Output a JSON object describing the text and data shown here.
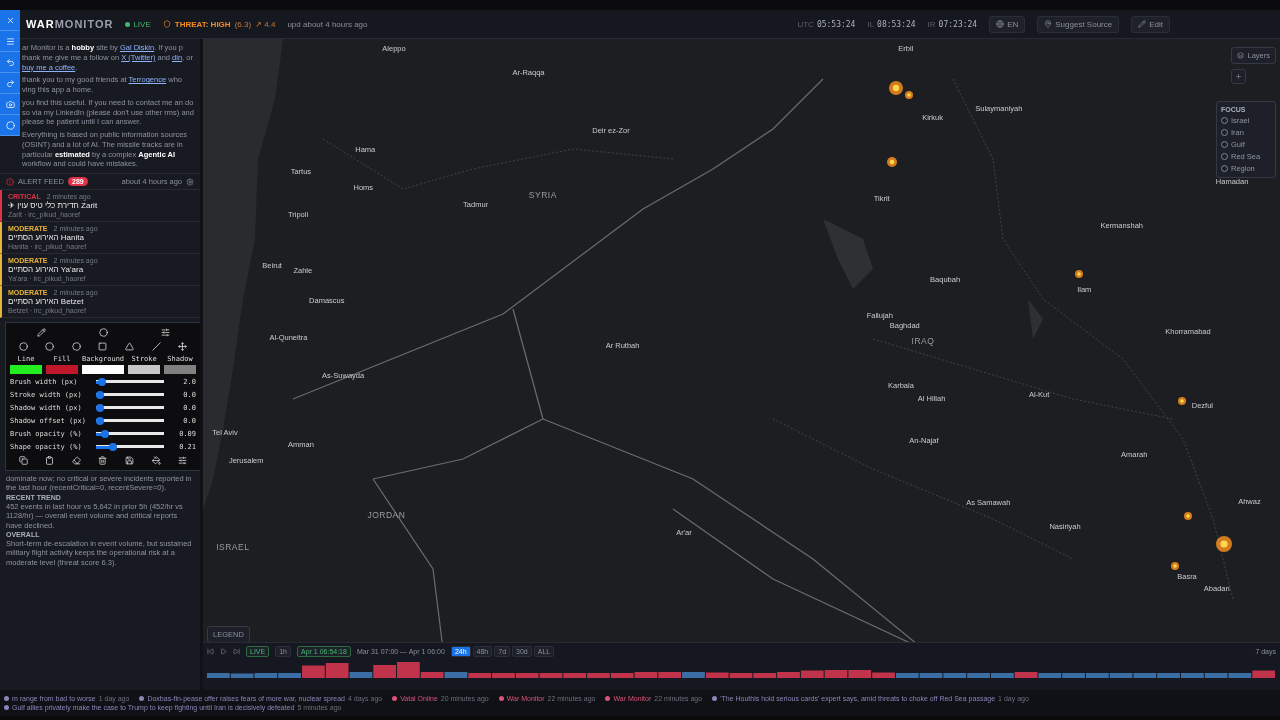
{
  "header": {
    "logo_strong": "WAR",
    "logo_rest": "MONITOR",
    "live": "LIVE",
    "threat": {
      "label": "THREAT: HIGH",
      "score": "(6.3)",
      "trend": "↗ 4.4"
    },
    "updated": "upd about 4 hours ago",
    "clocks": [
      {
        "zone": "UTC",
        "time": "05:53:24"
      },
      {
        "zone": "IL",
        "time": "08:53:24"
      },
      {
        "zone": "IR",
        "time": "07:23:24"
      }
    ],
    "language": "EN",
    "suggest": "Suggest Source",
    "edit": "Edit"
  },
  "about": [
    [
      {
        "kind": "text",
        "t": "ar Monitor is a "
      },
      {
        "kind": "bold",
        "t": "hobby"
      },
      {
        "kind": "text",
        "t": " site by "
      },
      {
        "kind": "link",
        "t": "Gal Diskin"
      },
      {
        "kind": "text",
        "t": ". If you p thank me give me a follow on "
      },
      {
        "kind": "link",
        "t": "X (Twitter)"
      },
      {
        "kind": "text",
        "t": " and "
      },
      {
        "kind": "link",
        "t": "din"
      },
      {
        "kind": "text",
        "t": ", or "
      },
      {
        "kind": "link",
        "t": "buy me a coffee"
      },
      {
        "kind": "text",
        "t": "."
      }
    ],
    [
      {
        "kind": "text",
        "t": "thank you to my good friends at "
      },
      {
        "kind": "link",
        "t": "Terrogence"
      },
      {
        "kind": "text",
        "t": " who ving this app a home."
      }
    ],
    [
      {
        "kind": "text",
        "t": "you find this useful. If you need to contact me an do so via my LinkedIn (please don't use other rms) and please be patient until I can answer."
      }
    ],
    [
      {
        "kind": "text",
        "t": "Everything is based on public information sources (OSINT) and a lot of AI. The missile tracks are in particular "
      },
      {
        "kind": "bold",
        "t": "estimated"
      },
      {
        "kind": "text",
        "t": " by a complex "
      },
      {
        "kind": "bold",
        "t": "Agentic AI"
      },
      {
        "kind": "text",
        "t": " workflow and could have mistakes."
      }
    ]
  ],
  "alert_feed": {
    "title": "ALERT FEED",
    "count": "289",
    "updated": "about 4 hours ago",
    "alerts": [
      {
        "severity": "CRITICAL",
        "kind": "critical",
        "time": "2 minutes ago",
        "title": "✈ חדירת כלי טיס עוין Zarit",
        "source": "Zarit · irc_pikud_haoref"
      },
      {
        "severity": "MODERATE",
        "kind": "moderate",
        "time": "2 minutes ago",
        "title": "האירוע הסתיים Hanita",
        "source": "Hanita · irc_pikud_haoref"
      },
      {
        "severity": "MODERATE",
        "kind": "moderate",
        "time": "2 minutes ago",
        "title": "האירוע הסתיים Ya'ara",
        "source": "Ya'ara · irc_pikud_haoref"
      },
      {
        "severity": "MODERATE",
        "kind": "moderate",
        "time": "2 minutes ago",
        "title": "האירוע הסתיים Betzet",
        "source": "Betzet · irc_pikud_haoref"
      }
    ]
  },
  "summary": [
    {
      "kind": "text",
      "t": "dominate now; no critical or severe incidents reported in the last hour (recentCritical=0, recentSevere=0)."
    },
    {
      "kind": "heading",
      "t": "RECENT TREND"
    },
    {
      "kind": "text",
      "t": "452 events in last hour vs 5,642 in prior 5h (452/hr vs 1128/hr) — overall event volume and critical reports have declined."
    },
    {
      "kind": "heading",
      "t": "OVERALL"
    },
    {
      "kind": "text",
      "t": "Short-term de-escalation in event volume, but sustained military flight activity keeps the operational risk at a moderate level (threat score 6.3)."
    }
  ],
  "drawing_panel": {
    "colors": [
      {
        "label": "Line",
        "color": "#22ee22"
      },
      {
        "label": "Fill",
        "color": "#c0182a"
      },
      {
        "label": "Background",
        "color": "#ffffff"
      },
      {
        "label": "Stroke",
        "color": "#c8c8c8"
      },
      {
        "label": "Shadow",
        "color": "#808080"
      }
    ],
    "sliders": [
      {
        "label": "Brush width (px)",
        "value": "2.0",
        "level": 0.04
      },
      {
        "label": "Stroke width (px)",
        "value": "0.0",
        "level": 0
      },
      {
        "label": "Shadow width (px)",
        "value": "0.0",
        "level": 0
      },
      {
        "label": "Shadow offset (px)",
        "value": "0.0",
        "level": 0
      },
      {
        "label": "Brush opacity (%)",
        "value": "0.09",
        "level": 0.09
      },
      {
        "label": "Shape opacity (%)",
        "value": "0.21",
        "level": 0.21
      }
    ]
  },
  "map": {
    "places": [
      {
        "name": "Aleppo",
        "kind": "city"
      },
      {
        "name": "Erbil",
        "kind": "city"
      },
      {
        "name": "Ar-Raqqa",
        "kind": "city"
      },
      {
        "name": "Sulaymaniyah",
        "kind": "city"
      },
      {
        "name": "Kirkuk",
        "kind": "city"
      },
      {
        "name": "Deir ez-Zor",
        "kind": "city"
      },
      {
        "name": "Hama",
        "kind": "city"
      },
      {
        "name": "Tartus",
        "kind": "city"
      },
      {
        "name": "Homs",
        "kind": "city"
      },
      {
        "name": "SYRIA",
        "kind": "country"
      },
      {
        "name": "Tikrit",
        "kind": "city"
      },
      {
        "name": "Tadmur",
        "kind": "city"
      },
      {
        "name": "Tripoli",
        "kind": "city"
      },
      {
        "name": "Hamadan",
        "kind": "city"
      },
      {
        "name": "Kermanshah",
        "kind": "city"
      },
      {
        "name": "Beirut",
        "kind": "city"
      },
      {
        "name": "Zahle",
        "kind": "city"
      },
      {
        "name": "Baqubah",
        "kind": "city"
      },
      {
        "name": "Ilam",
        "kind": "city"
      },
      {
        "name": "Damascus",
        "kind": "city"
      },
      {
        "name": "Fallujah",
        "kind": "city"
      },
      {
        "name": "Baghdad",
        "kind": "city"
      },
      {
        "name": "Khorramabad",
        "kind": "city"
      },
      {
        "name": "Al-Quneitra",
        "kind": "city"
      },
      {
        "name": "IRAQ",
        "kind": "country"
      },
      {
        "name": "Ar Rutbah",
        "kind": "city"
      },
      {
        "name": "As-Suwayda",
        "kind": "city"
      },
      {
        "name": "Karbala",
        "kind": "city"
      },
      {
        "name": "Al-Kut",
        "kind": "city"
      },
      {
        "name": "Al Hillah",
        "kind": "city"
      },
      {
        "name": "Dezful",
        "kind": "city"
      },
      {
        "name": "Tel Aviv",
        "kind": "city"
      },
      {
        "name": "An-Najaf",
        "kind": "city"
      },
      {
        "name": "Amman",
        "kind": "city"
      },
      {
        "name": "Amarah",
        "kind": "city"
      },
      {
        "name": "Jerusalem",
        "kind": "city"
      },
      {
        "name": "As Samawah",
        "kind": "city"
      },
      {
        "name": "Ahwaz",
        "kind": "city"
      },
      {
        "name": "JORDAN",
        "kind": "country"
      },
      {
        "name": "Nasiriyah",
        "kind": "city"
      },
      {
        "name": "Ar'ar",
        "kind": "city"
      },
      {
        "name": "ISRAEL",
        "kind": "country"
      },
      {
        "name": "Basra",
        "kind": "city"
      },
      {
        "name": "Abadan",
        "kind": "city"
      }
    ],
    "legend": "LEGEND",
    "layers": "Layers",
    "focus": {
      "title": "FOCUS",
      "options": [
        {
          "label": "Israel",
          "selected": false
        },
        {
          "label": "Iran",
          "selected": false
        },
        {
          "label": "Gulf",
          "selected": false
        },
        {
          "label": "Red Sea",
          "selected": false
        },
        {
          "label": "Region",
          "selected": false
        }
      ]
    }
  },
  "timeline": {
    "live": "LIVE",
    "step": "1h",
    "current": "Apr 1 06:54:18",
    "range": "Mar 31 07:00 — Apr 1 06:00",
    "spans": [
      {
        "label": "24h",
        "selected": true
      },
      {
        "label": "48h",
        "selected": false
      },
      {
        "label": "7d",
        "selected": false
      },
      {
        "label": "30d",
        "selected": false
      },
      {
        "label": "ALL",
        "selected": false
      }
    ],
    "extent": "7 days"
  },
  "ticker": [
    {
      "kind": "headline",
      "t": "m range from bad to worse",
      "time": "1 day ago"
    },
    {
      "kind": "headline",
      "t": "Doxbas-fin-pease offer raises fears of more war, nuclear spread",
      "time": "4 days ago"
    },
    {
      "kind": "source",
      "t": "Vatal Online",
      "time": "20 minutes ago"
    },
    {
      "kind": "source",
      "t": "War Monitor",
      "time": "22 minutes ago"
    },
    {
      "kind": "source",
      "t": "War Monitor",
      "time": "22 minutes ago"
    },
    {
      "kind": "headline",
      "t": "'The Houthis hold serious cards' expert says, amid threats to choke off Red Sea passage",
      "time": "1 day ago"
    },
    {
      "kind": "headline",
      "t": "Gulf allies privately make the case to Trump to keep fighting until Iran is decisively defeated",
      "time": "5 minutes ago"
    }
  ]
}
